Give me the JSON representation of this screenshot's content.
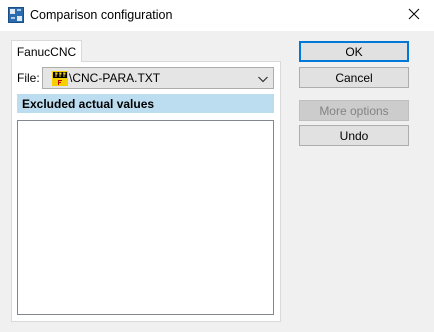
{
  "window": {
    "title": "Comparison configuration"
  },
  "tabs": [
    {
      "label": "FanucCNC",
      "active": true
    }
  ],
  "file": {
    "label": "File:",
    "value": "\\CNC-PARA.TXT"
  },
  "section": {
    "header": "Excluded actual values"
  },
  "buttons": {
    "ok": "OK",
    "cancel": "Cancel",
    "more_options": "More options",
    "undo": "Undo"
  },
  "colors": {
    "section_header_bg": "#bcdcef",
    "default_button_border": "#0078d7"
  }
}
